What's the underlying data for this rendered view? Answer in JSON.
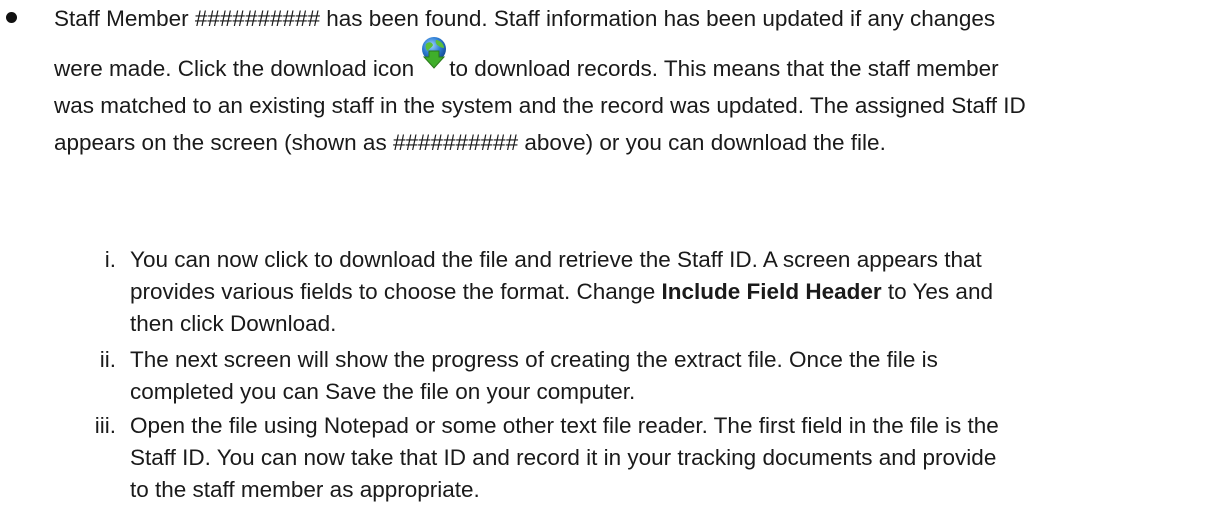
{
  "bullet": {
    "line1": "Staff Member ########## has been found. Staff information has been updated if any changes",
    "line2_before_icon": "were made.  Click the download icon",
    "line2_after_icon": "to download records. This means that the staff member",
    "line3": "was matched to an existing staff in the system and the record was updated.  The assigned Staff ID",
    "line4": "appears on the screen (shown as ########## above) or you can download the file.",
    "icon": "download-globe-icon",
    "icon_colors": {
      "globe": "#2f7fd6",
      "land": "#5bbf3a",
      "arrow": "#3fae2a"
    }
  },
  "steps": [
    {
      "marker": "i.",
      "lines": [
        {
          "text": "You can now click to download the file and retrieve the Staff ID. A screen appears that"
        },
        {
          "text": "provides various fields to choose the format.  Change ",
          "bold": "Include Field Header",
          "after": " to Yes and"
        },
        {
          "text": "then click Download."
        }
      ]
    },
    {
      "marker": "ii.",
      "lines": [
        {
          "text": "The next screen will show the progress of creating the extract file.  Once the file is"
        },
        {
          "text": "completed you can Save the file on your computer."
        }
      ]
    },
    {
      "marker": "iii.",
      "lines": [
        {
          "text": "Open the file using Notepad or some other text file reader. The first field in the file is the"
        },
        {
          "text": "Staff ID.  You can now take that ID and record it in your tracking documents and provide"
        },
        {
          "text": "to the staff member as appropriate."
        }
      ]
    }
  ]
}
